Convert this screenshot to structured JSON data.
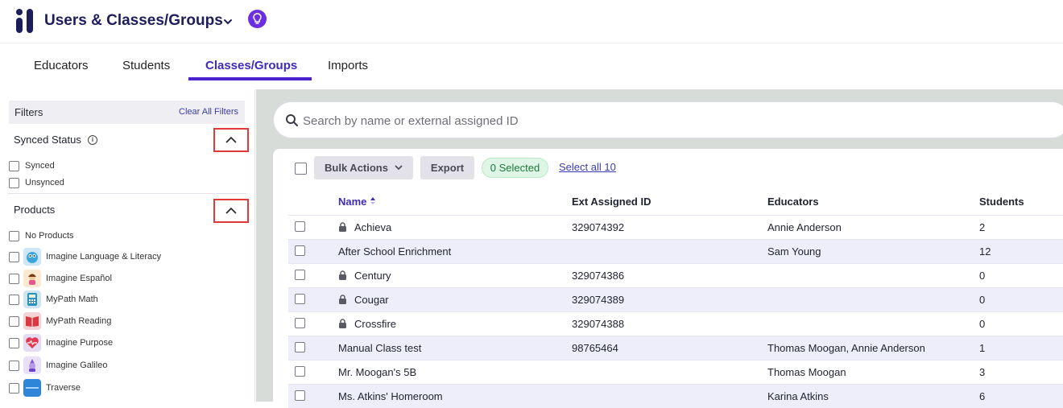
{
  "header": {
    "title": "Users & Classes/Groups",
    "colors": {
      "brand": "#1e1d5c",
      "accent": "#4a22d0"
    }
  },
  "tabs": [
    {
      "label": "Educators"
    },
    {
      "label": "Students"
    },
    {
      "label": "Classes/Groups",
      "active": true
    },
    {
      "label": "Imports"
    }
  ],
  "sidebar": {
    "filters_label": "Filters",
    "clear_all": "Clear All Filters",
    "synced_status": {
      "title": "Synced Status",
      "options": [
        "Synced",
        "Unsynced"
      ]
    },
    "products": {
      "title": "Products",
      "no_products": "No Products",
      "items": [
        {
          "label": "Imagine Language & Literacy",
          "icon": "monster-icon"
        },
        {
          "label": "Imagine Español",
          "icon": "girl-icon"
        },
        {
          "label": "MyPath Math",
          "icon": "calculator-icon"
        },
        {
          "label": "MyPath Reading",
          "icon": "book-icon"
        },
        {
          "label": "Imagine Purpose",
          "icon": "heart-icon"
        },
        {
          "label": "Imagine Galileo",
          "icon": "character-icon"
        },
        {
          "label": "Traverse",
          "icon": "traverse-icon"
        }
      ]
    }
  },
  "search": {
    "placeholder": "Search by name or external assigned ID"
  },
  "toolbar": {
    "bulk_actions": "Bulk Actions",
    "export": "Export",
    "selected": "0 Selected",
    "select_all": "Select all 10"
  },
  "table": {
    "columns": [
      "Name",
      "Ext Assigned ID",
      "Educators",
      "Students"
    ],
    "rows": [
      {
        "name": "Achieva",
        "locked": true,
        "ext_id": "329074392",
        "educators": "Annie Anderson",
        "students": "2"
      },
      {
        "name": "After School Enrichment",
        "locked": false,
        "ext_id": "",
        "educators": "Sam Young",
        "students": "12"
      },
      {
        "name": "Century",
        "locked": true,
        "ext_id": "329074386",
        "educators": "",
        "students": "0"
      },
      {
        "name": "Cougar",
        "locked": true,
        "ext_id": "329074389",
        "educators": "",
        "students": "0"
      },
      {
        "name": "Crossfire",
        "locked": true,
        "ext_id": "329074388",
        "educators": "",
        "students": "0"
      },
      {
        "name": "Manual Class test",
        "locked": false,
        "ext_id": "98765464",
        "educators": "Thomas Moogan, Annie Anderson",
        "students": "1"
      },
      {
        "name": "Mr. Moogan's 5B",
        "locked": false,
        "ext_id": "",
        "educators": "Thomas Moogan",
        "students": "3"
      },
      {
        "name": "Ms. Atkins' Homeroom",
        "locked": false,
        "ext_id": "",
        "educators": "Karina Atkins",
        "students": "6"
      }
    ]
  }
}
